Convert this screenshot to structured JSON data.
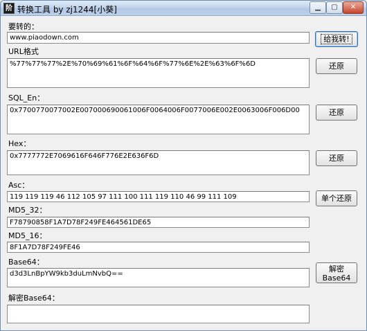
{
  "window": {
    "title": "转换工具 by zj1244[小葵]",
    "icon_text": "阶",
    "min_glyph": "▁",
    "max_glyph": "▢",
    "close_glyph": "✕"
  },
  "fields": {
    "source": {
      "label": "要转的：",
      "value": "www.piaodown.com"
    },
    "url": {
      "label": "URL格式",
      "value": "%77%77%77%2E%70%69%61%6F%64%6F%77%6E%2E%63%6F%6D"
    },
    "sql_en": {
      "label": "SQL_En：",
      "value": "0x7700770077002E007000690061006F0064006F0077006E002E0063006F006D00"
    },
    "hex": {
      "label": "Hex：",
      "value": "0x7777772E7069616F646F776E2E636F6D"
    },
    "asc": {
      "label": "Asc：",
      "value": "119 119 119 46 112 105 97 111 100 111 119 110 46 99 111 109"
    },
    "md5_32": {
      "label": "MD5_32：",
      "value": "F78790858F1A7D78F249FE464561DE65"
    },
    "md5_16": {
      "label": "MD5_16：",
      "value": "8F1A7D78F249FE46"
    },
    "base64": {
      "label": "Base64：",
      "value": "d3d3LnBpYW9kb3duLmNvbQ=="
    },
    "base64_decode": {
      "label": "解密Base64：",
      "value": ""
    }
  },
  "buttons": {
    "convert": "给我转!",
    "restore_url": "还原",
    "restore_sql": "还原",
    "restore_hex": "还原",
    "restore_single": "单个还原",
    "decode_base64_line1": "解密",
    "decode_base64_line2": "Base64"
  }
}
